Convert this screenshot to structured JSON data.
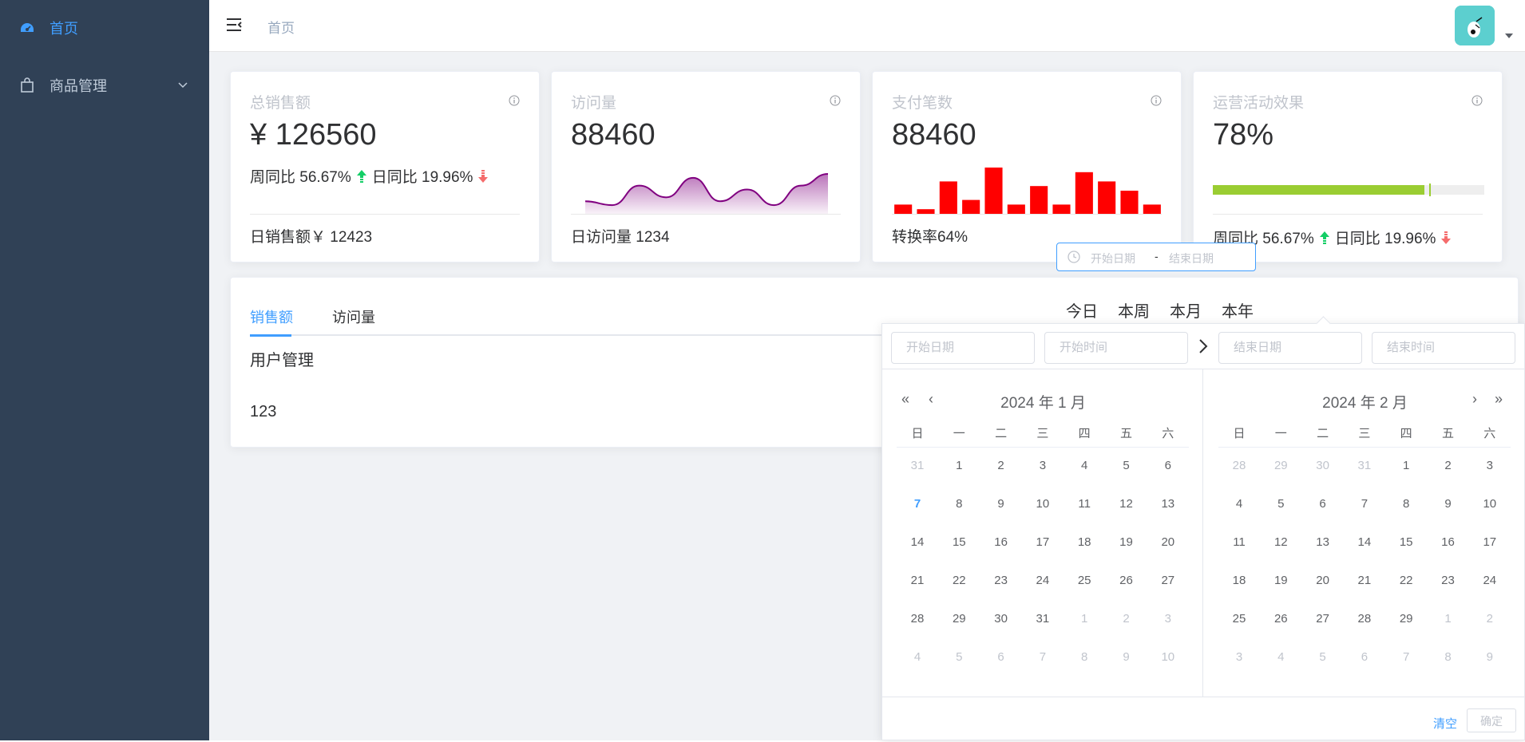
{
  "sidebar": {
    "items": [
      {
        "label": "首页",
        "icon": "dashboard-icon",
        "active": true
      },
      {
        "label": "商品管理",
        "icon": "shopping-bag-icon",
        "expandable": true
      }
    ]
  },
  "header": {
    "breadcrumb": "首页"
  },
  "cards": [
    {
      "title": "总销售额",
      "value": "¥ 126560",
      "trend_week_label": "周同比 56.67%",
      "trend_day_label": "日同比 19.96%",
      "footer": "日销售额￥ 12423"
    },
    {
      "title": "访问量",
      "value": "88460",
      "footer": "日访问量 1234"
    },
    {
      "title": "支付笔数",
      "value": "88460",
      "footer": "转换率64%"
    },
    {
      "title": "运营活动效果",
      "value": "78%",
      "trend_week_label": "周同比 56.67%",
      "trend_day_label": "日同比 19.96%",
      "progress": 0.78
    }
  ],
  "panel": {
    "tabs": [
      "销售额",
      "访问量"
    ],
    "active_tab": 0,
    "label": "用户管理",
    "number": "123",
    "ranges": [
      "今日",
      "本周",
      "本月",
      "本年"
    ],
    "date_input": {
      "start_placeholder": "开始日期",
      "separator": "-",
      "end_placeholder": "结束日期"
    }
  },
  "picker": {
    "start_date_placeholder": "开始日期",
    "start_time_placeholder": "开始时间",
    "end_date_placeholder": "结束日期",
    "end_time_placeholder": "结束时间",
    "left_title": "2024 年 1 月",
    "right_title": "2024 年 2 月",
    "weekdays": [
      "日",
      "一",
      "二",
      "三",
      "四",
      "五",
      "六"
    ],
    "left_days": [
      [
        "31",
        "1",
        "2",
        "3",
        "4",
        "5",
        "6"
      ],
      [
        "7",
        "8",
        "9",
        "10",
        "11",
        "12",
        "13"
      ],
      [
        "14",
        "15",
        "16",
        "17",
        "18",
        "19",
        "20"
      ],
      [
        "21",
        "22",
        "23",
        "24",
        "25",
        "26",
        "27"
      ],
      [
        "28",
        "29",
        "30",
        "31",
        "1",
        "2",
        "3"
      ],
      [
        "4",
        "5",
        "6",
        "7",
        "8",
        "9",
        "10"
      ]
    ],
    "right_days": [
      [
        "28",
        "29",
        "30",
        "31",
        "1",
        "2",
        "3"
      ],
      [
        "4",
        "5",
        "6",
        "7",
        "8",
        "9",
        "10"
      ],
      [
        "11",
        "12",
        "13",
        "14",
        "15",
        "16",
        "17"
      ],
      [
        "18",
        "19",
        "20",
        "21",
        "22",
        "23",
        "24"
      ],
      [
        "25",
        "26",
        "27",
        "28",
        "29",
        "1",
        "2"
      ],
      [
        "3",
        "4",
        "5",
        "6",
        "7",
        "8",
        "9"
      ]
    ],
    "clear_label": "清空",
    "confirm_label": "确定"
  },
  "colors": {
    "sidebar_bg": "#304156",
    "accent": "#409eff",
    "area_chart": "#800080",
    "bar_chart": "#ff0000",
    "progress": "#9acd32"
  },
  "chart_data": [
    {
      "type": "area",
      "values": [
        2,
        1,
        6,
        3,
        8,
        2,
        5,
        1,
        6,
        9
      ]
    },
    {
      "type": "bar",
      "values": [
        2,
        1,
        7,
        3,
        10,
        2,
        6,
        2,
        9,
        7,
        5,
        2
      ]
    }
  ]
}
